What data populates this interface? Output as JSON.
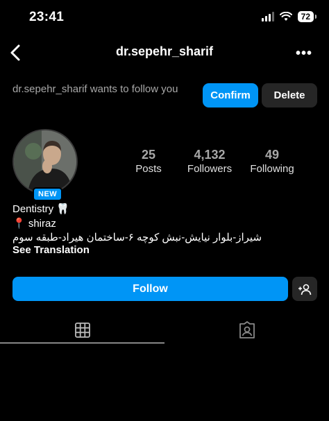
{
  "status_bar": {
    "time": "23:41",
    "battery": "72"
  },
  "header": {
    "username": "dr.sepehr_sharif",
    "more": "•••"
  },
  "follow_request": {
    "text": "dr.sepehr_sharif wants to follow you",
    "confirm_label": "Confirm",
    "delete_label": "Delete"
  },
  "profile": {
    "badge": "NEW",
    "stats": [
      {
        "value": "25",
        "label": "Posts"
      },
      {
        "value": "4,132",
        "label": "Followers"
      },
      {
        "value": "49",
        "label": "Following"
      }
    ],
    "bio": {
      "line1": "Dentistry 🦷",
      "line2": "📍 shiraz",
      "line3": "شیراز-بلوار نیایش-نبش کوچه ۶-ساختمان هیراد-طبقه سوم",
      "see_translation": "See Translation"
    }
  },
  "actions": {
    "follow_label": "Follow"
  },
  "tabs": [
    {
      "icon": "grid-icon",
      "active": true
    },
    {
      "icon": "tagged-icon",
      "active": false
    }
  ],
  "colors": {
    "accent": "#0095f6",
    "secondary_button": "#262626",
    "background": "#000000"
  }
}
